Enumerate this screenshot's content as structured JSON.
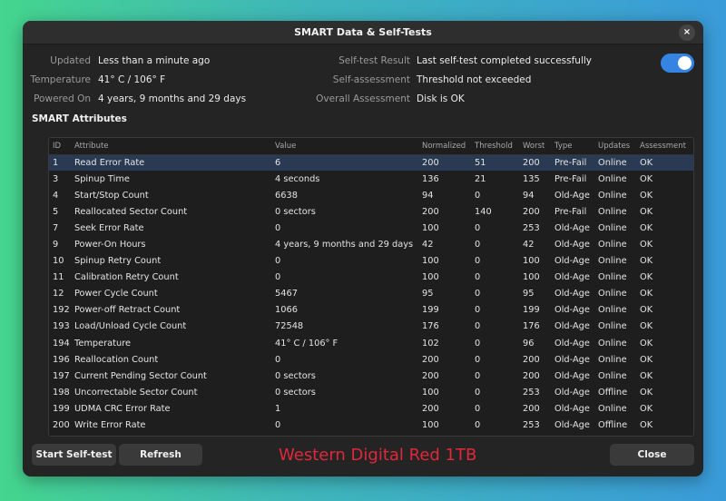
{
  "window": {
    "title": "SMART Data & Self-Tests",
    "close_glyph": "×"
  },
  "info_left": [
    {
      "label": "Updated",
      "value": "Less than a minute ago"
    },
    {
      "label": "Temperature",
      "value": "41° C / 106° F"
    },
    {
      "label": "Powered On",
      "value": "4 years, 9 months and 29 days"
    }
  ],
  "info_right": [
    {
      "label": "Self-test Result",
      "value": "Last self-test completed successfully"
    },
    {
      "label": "Self-assessment",
      "value": "Threshold not exceeded"
    },
    {
      "label": "Overall Assessment",
      "value": "Disk is OK"
    }
  ],
  "smart_toggle": {
    "state": "on",
    "color": "#3584e4"
  },
  "section_title": "SMART Attributes",
  "table": {
    "headers": [
      "ID",
      "Attribute",
      "Value",
      "Normalized",
      "Threshold",
      "Worst",
      "Type",
      "Updates",
      "Assessment"
    ],
    "rows": [
      [
        "1",
        "Read Error Rate",
        "6",
        "200",
        "51",
        "200",
        "Pre-Fail",
        "Online",
        "OK"
      ],
      [
        "3",
        "Spinup Time",
        "4 seconds",
        "136",
        "21",
        "135",
        "Pre-Fail",
        "Online",
        "OK"
      ],
      [
        "4",
        "Start/Stop Count",
        "6638",
        "94",
        "0",
        "94",
        "Old-Age",
        "Online",
        "OK"
      ],
      [
        "5",
        "Reallocated Sector Count",
        "0 sectors",
        "200",
        "140",
        "200",
        "Pre-Fail",
        "Online",
        "OK"
      ],
      [
        "7",
        "Seek Error Rate",
        "0",
        "100",
        "0",
        "253",
        "Old-Age",
        "Online",
        "OK"
      ],
      [
        "9",
        "Power-On Hours",
        "4 years, 9 months and 29 days",
        "42",
        "0",
        "42",
        "Old-Age",
        "Online",
        "OK"
      ],
      [
        "10",
        "Spinup Retry Count",
        "0",
        "100",
        "0",
        "100",
        "Old-Age",
        "Online",
        "OK"
      ],
      [
        "11",
        "Calibration Retry Count",
        "0",
        "100",
        "0",
        "100",
        "Old-Age",
        "Online",
        "OK"
      ],
      [
        "12",
        "Power Cycle Count",
        "5467",
        "95",
        "0",
        "95",
        "Old-Age",
        "Online",
        "OK"
      ],
      [
        "192",
        "Power-off Retract Count",
        "1066",
        "199",
        "0",
        "199",
        "Old-Age",
        "Online",
        "OK"
      ],
      [
        "193",
        "Load/Unload Cycle Count",
        "72548",
        "176",
        "0",
        "176",
        "Old-Age",
        "Online",
        "OK"
      ],
      [
        "194",
        "Temperature",
        "41° C / 106° F",
        "102",
        "0",
        "96",
        "Old-Age",
        "Online",
        "OK"
      ],
      [
        "196",
        "Reallocation Count",
        "0",
        "200",
        "0",
        "200",
        "Old-Age",
        "Online",
        "OK"
      ],
      [
        "197",
        "Current Pending Sector Count",
        "0 sectors",
        "200",
        "0",
        "200",
        "Old-Age",
        "Online",
        "OK"
      ],
      [
        "198",
        "Uncorrectable Sector Count",
        "0 sectors",
        "100",
        "0",
        "253",
        "Old-Age",
        "Offline",
        "OK"
      ],
      [
        "199",
        "UDMA CRC Error Rate",
        "1",
        "200",
        "0",
        "200",
        "Old-Age",
        "Online",
        "OK"
      ],
      [
        "200",
        "Write Error Rate",
        "0",
        "100",
        "0",
        "253",
        "Old-Age",
        "Offline",
        "OK"
      ]
    ],
    "selected_row": 0
  },
  "buttons": {
    "start_self_test": "Start Self-test",
    "refresh": "Refresh",
    "close": "Close"
  },
  "model_label": "Western Digital Red 1TB",
  "colors": {
    "accent": "#3584e4",
    "model_text": "#e0283a",
    "selection": "#2a3a52"
  }
}
